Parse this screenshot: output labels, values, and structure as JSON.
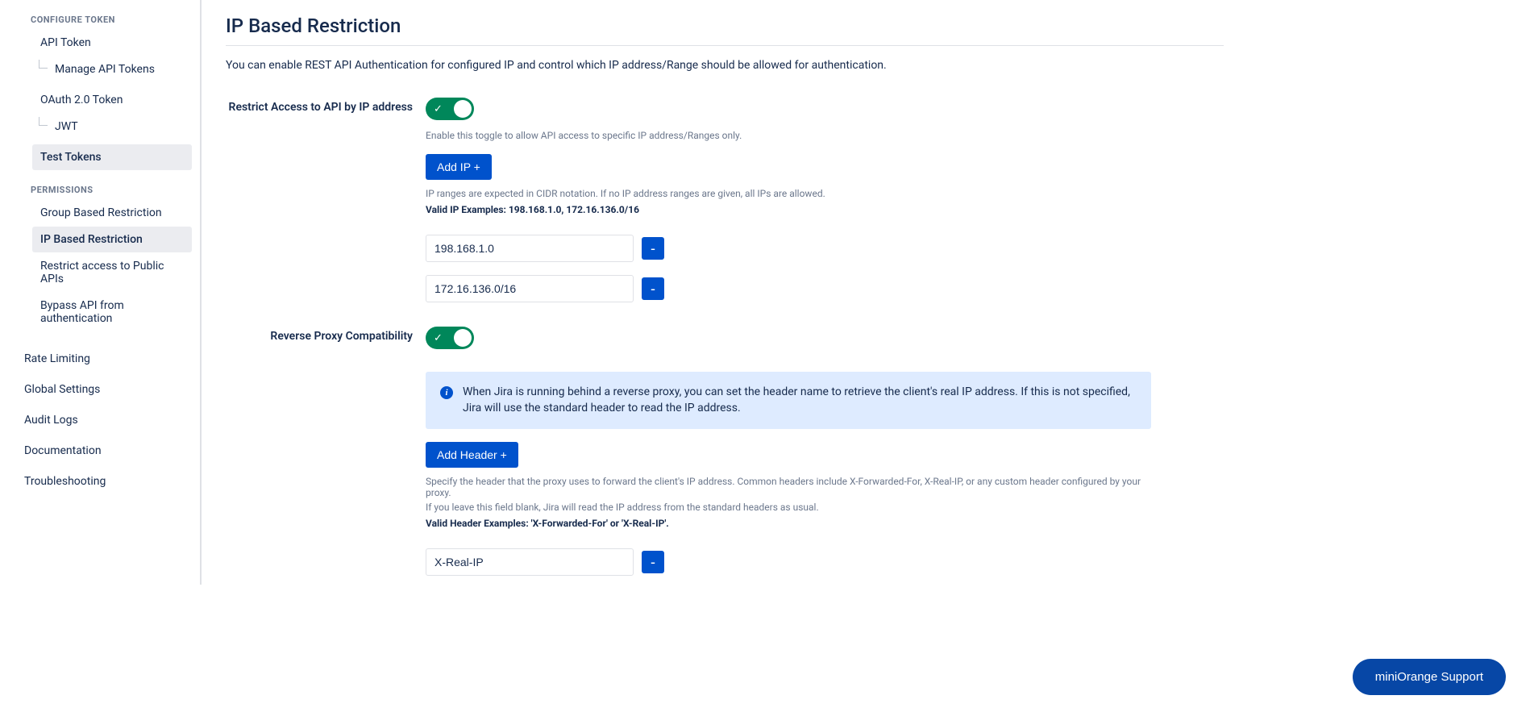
{
  "sidebar": {
    "section_configure": "CONFIGURE TOKEN",
    "api_token": "API Token",
    "manage_api_tokens": "Manage API Tokens",
    "oauth20_token": "OAuth 2.0 Token",
    "jwt": "JWT",
    "test_tokens": "Test Tokens",
    "section_permissions": "PERMISSIONS",
    "group_based": "Group Based Restriction",
    "ip_based": "IP Based Restriction",
    "restrict_public": "Restrict access to Public APIs",
    "bypass_api": "Bypass API from authentication",
    "rate_limiting": "Rate Limiting",
    "global_settings": "Global Settings",
    "audit_logs": "Audit Logs",
    "documentation": "Documentation",
    "troubleshooting": "Troubleshooting"
  },
  "main": {
    "title": "IP Based Restriction",
    "desc": "You can enable REST API Authentication for configured IP and control which IP address/Range should be allowed for authentication.",
    "restrict_label": "Restrict Access to API by IP address",
    "restrict_help": "Enable this toggle to allow API access to specific IP address/Ranges only.",
    "add_ip_btn": "Add IP +",
    "ip_help": "IP ranges are expected in CIDR notation. If no IP address ranges are given, all IPs are allowed.",
    "ip_examples": "Valid IP Examples: 198.168.1.0, 172.16.136.0/16",
    "ip_values": [
      "198.168.1.0",
      "172.16.136.0/16"
    ],
    "remove_label": "-",
    "reverse_label": "Reverse Proxy Compatibility",
    "info_text": "When Jira is running behind a reverse proxy, you can set the header name to retrieve the client's real IP address. If this is not specified, Jira will use the standard header to read the IP address.",
    "add_header_btn": "Add Header +",
    "header_help1": "Specify the header that the proxy uses to forward the client's IP address. Common headers include X-Forwarded-For, X-Real-IP, or any custom header configured by your proxy.",
    "header_help2": "If you leave this field blank, Jira will read the IP address from the standard headers as usual.",
    "header_examples": "Valid Header Examples: 'X-Forwarded-For' or 'X-Real-IP'.",
    "header_values": [
      "X-Real-IP"
    ]
  },
  "support_btn": "miniOrange Support"
}
